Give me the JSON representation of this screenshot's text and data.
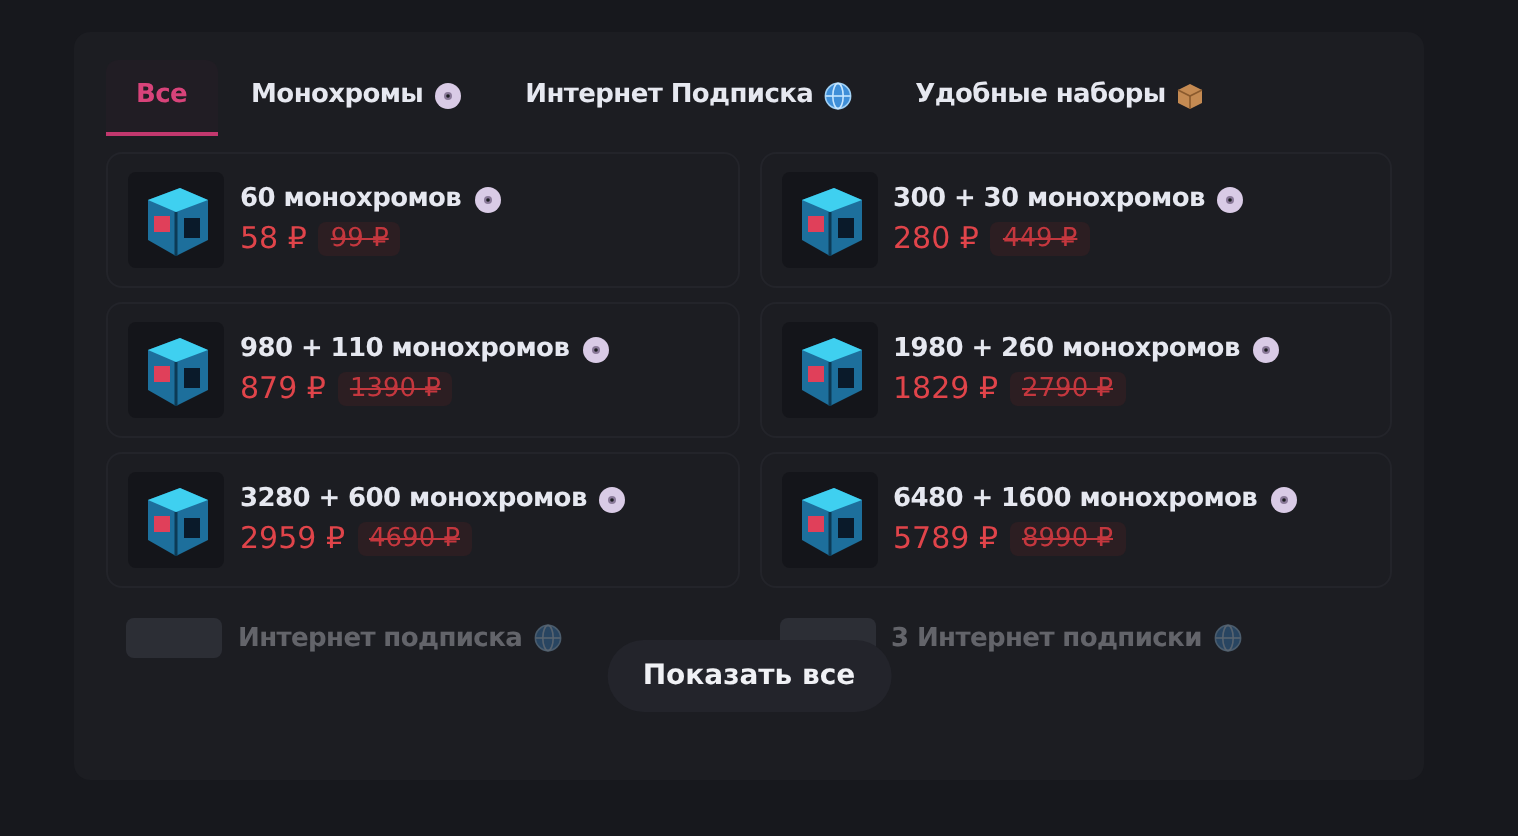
{
  "tabs": [
    {
      "label": "Все",
      "selected": true
    },
    {
      "label": "Монохромы",
      "selected": false
    },
    {
      "label": "Интернет Подписка",
      "selected": false
    },
    {
      "label": "Удобные наборы",
      "selected": false
    }
  ],
  "products": [
    {
      "title": "60 монохромов",
      "price": "58 ₽",
      "old_price": "99 ₽"
    },
    {
      "title": "300 + 30 монохромов",
      "price": "280 ₽",
      "old_price": "449 ₽"
    },
    {
      "title": "980 + 110 монохромов",
      "price": "879 ₽",
      "old_price": "1390 ₽"
    },
    {
      "title": "1980 + 260 монохромов",
      "price": "1829 ₽",
      "old_price": "2790 ₽"
    },
    {
      "title": "3280 + 600 монохромов",
      "price": "2959 ₽",
      "old_price": "4690 ₽"
    },
    {
      "title": "6480 + 1600 монохромов",
      "price": "5789 ₽",
      "old_price": "8990 ₽"
    }
  ],
  "faded_products": [
    {
      "title": "Интернет подписка"
    },
    {
      "title": "3 Интернет подписки"
    }
  ],
  "show_all_button": "Показать все"
}
